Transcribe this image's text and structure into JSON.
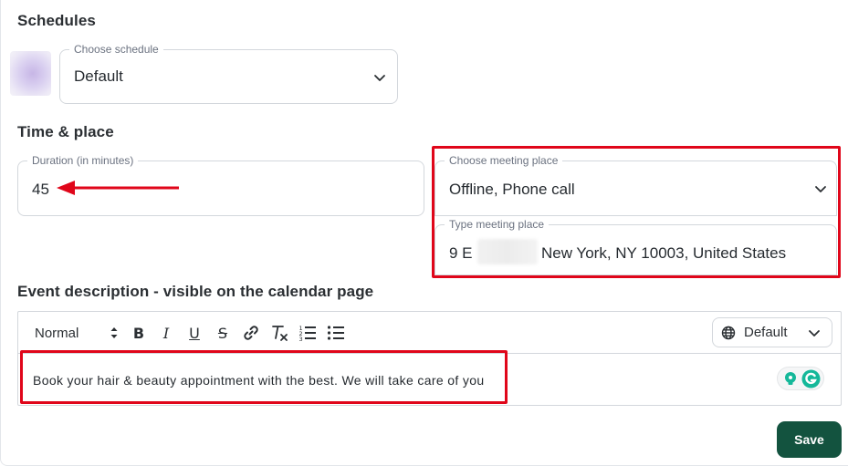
{
  "schedules": {
    "title": "Schedules",
    "choose_schedule": {
      "label": "Choose schedule",
      "value": "Default"
    }
  },
  "time_place": {
    "title": "Time & place",
    "duration": {
      "label": "Duration (in minutes)",
      "value": "45"
    },
    "meeting_place": {
      "label": "Choose meeting place",
      "value": "Offline, Phone call"
    },
    "type_place": {
      "label": "Type meeting place",
      "value_start": "9 E",
      "value_end": "New York, NY 10003, United States"
    }
  },
  "description": {
    "title": "Event description - visible on the calendar page",
    "toolbar": {
      "format_select": "Normal",
      "buttons": [
        "bold-icon",
        "italic-icon",
        "underline-icon",
        "strikethrough-icon",
        "link-icon",
        "clear-format-icon",
        "ordered-list-icon",
        "bullet-list-icon"
      ],
      "language_select": "Default"
    },
    "text": "Book your hair & beauty appointment with the best. We will take care of you"
  },
  "save_label": "Save",
  "colors": {
    "accent": "#13533f",
    "annotation": "#e0061a"
  }
}
